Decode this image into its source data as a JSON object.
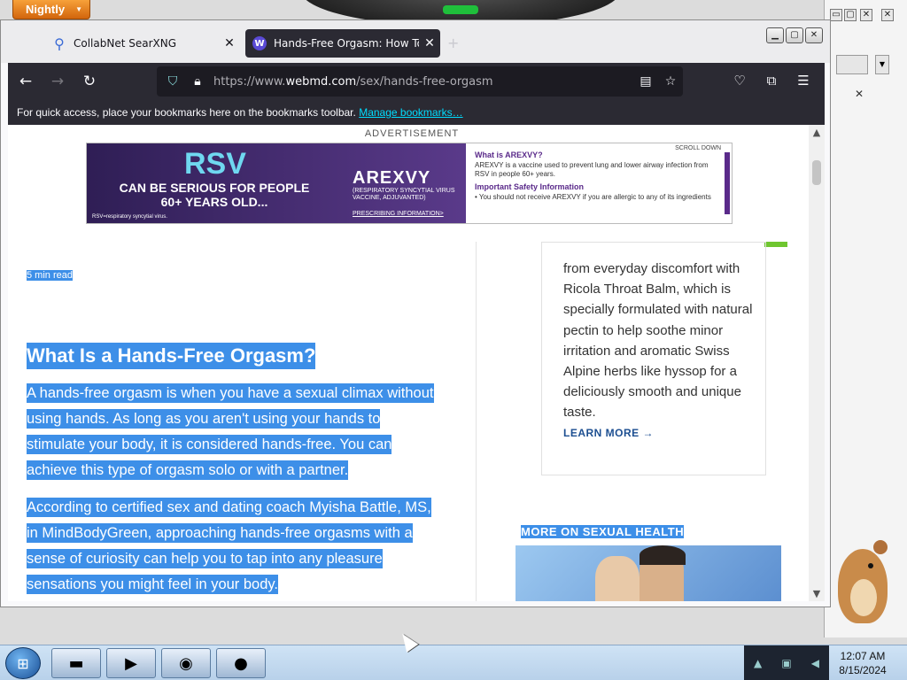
{
  "desktop": {
    "nightly_button": "Nightly",
    "background_close": "✕"
  },
  "browser": {
    "tabs": [
      {
        "label": "CollabNet SearXNG",
        "icon": "search-icon",
        "active": false
      },
      {
        "label": "Hands-Free Orgasm: How To D",
        "icon": "webmd-icon",
        "active": true
      }
    ],
    "new_tab": "+",
    "url_prefix": "https://www.",
    "url_domain": "webmd.com",
    "url_path": "/sex/hands-free-orgasm",
    "bookmarks_text": "For quick access, place your bookmarks here on the bookmarks toolbar.",
    "bookmarks_link": "Manage bookmarks…"
  },
  "ad": {
    "label": "ADVERTISEMENT",
    "rsv": "RSV",
    "headline": "CAN BE SERIOUS FOR PEOPLE 60+ YEARS OLD...",
    "brand": "AREXVY",
    "brand_sub": "(RESPIRATORY SYNCYTIAL VIRUS VACCINE, ADJUVANTED)",
    "prescribing": "PRESCRIBING INFORMATION>",
    "footnote": "RSV=respiratory syncytial virus.",
    "scroll_down": "SCROLL DOWN",
    "what_title": "What is AREXVY?",
    "what_text": "AREXVY is a vaccine used to prevent lung and lower airway infection from RSV in people 60+ years.",
    "safety_title": "Important Safety Information",
    "safety_text": "• You should not receive AREXVY if you are allergic to any of its ingredients"
  },
  "article": {
    "read_time": "5 min read",
    "heading": "What Is a Hands-Free Orgasm?",
    "p1_lines": [
      "A hands-free orgasm is when you have a sexual climax without",
      "using hands. As long as you aren't using your hands to",
      "stimulate your body, it is considered hands-free. You can",
      "achieve this type of orgasm solo or with a partner."
    ],
    "p2_lines": [
      "According to certified sex and dating coach Myisha Battle, MS,",
      "in MindBodyGreen, approaching hands-free orgasms with a",
      "sense of curiosity can help you to tap into any pleasure",
      "sensations you might feel in your body."
    ]
  },
  "sidebar": {
    "card_text": "from everyday discomfort with Ricola Throat Balm, which is specially formulated with natural pectin to help soothe minor irritation and aromatic Swiss Alpine herbs like hyssop for a deliciously smooth and unique taste.",
    "learn_more": "LEARN MORE →",
    "more_heading": "MORE ON SEXUAL HEALTH"
  },
  "taskbar": {
    "time": "12:07 AM",
    "date": "8/15/2024"
  },
  "colors": {
    "selection": "#3d8fe8",
    "toolbar": "#2b2a33",
    "link": "#00ddff",
    "nightly": "#e07a1a"
  }
}
